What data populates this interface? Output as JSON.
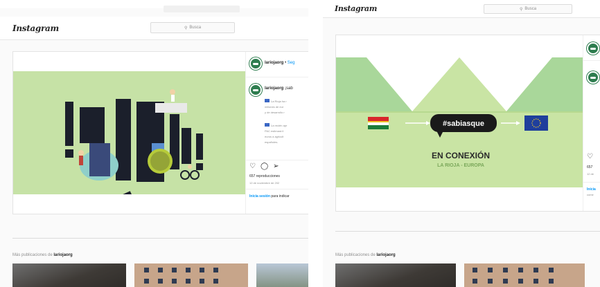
{
  "app": {
    "logo": "Instagram",
    "search_placeholder": "Busca"
  },
  "left_post": {
    "username": "lariojaorg",
    "follow_separator": "•",
    "follow_label": "Seg",
    "caption_username": "lariojaorg",
    "caption_snippet": "¡sab",
    "lines": [
      {
        "text": "La Rioja ha r"
      },
      {
        "text": "millones de eur"
      },
      {
        "text": "y de desarrollo r"
      },
      {
        "text": "La recién apr"
      },
      {
        "text": "PAC estimará il"
      },
      {
        "text": "euros a agricult"
      },
      {
        "text": "españoles."
      }
    ],
    "reproductions": "657 reproducciones",
    "date": "12 de noviembre de 202",
    "login_link": "Inicia sesión",
    "login_rest": "para indicar"
  },
  "right_post": {
    "hashtag": "#sabiasque",
    "title": "EN CONEXIÓN",
    "subtitle": "LA RIOJA - EUROPA",
    "reproductions": "657",
    "date": "12 de",
    "login_link": "Inicia",
    "login_rest": "come"
  },
  "more_posts": {
    "prefix": "Más publicaciones de",
    "username": "lariojaorg"
  },
  "colors": {
    "accent": "#0095f6",
    "brand_green": "#2e7d4f",
    "image_green": "#c6e2a6",
    "bubble": "#1a1a1a"
  },
  "icons": [
    "heart-icon",
    "comment-icon",
    "share-icon",
    "search-icon",
    "avatar-icon"
  ]
}
